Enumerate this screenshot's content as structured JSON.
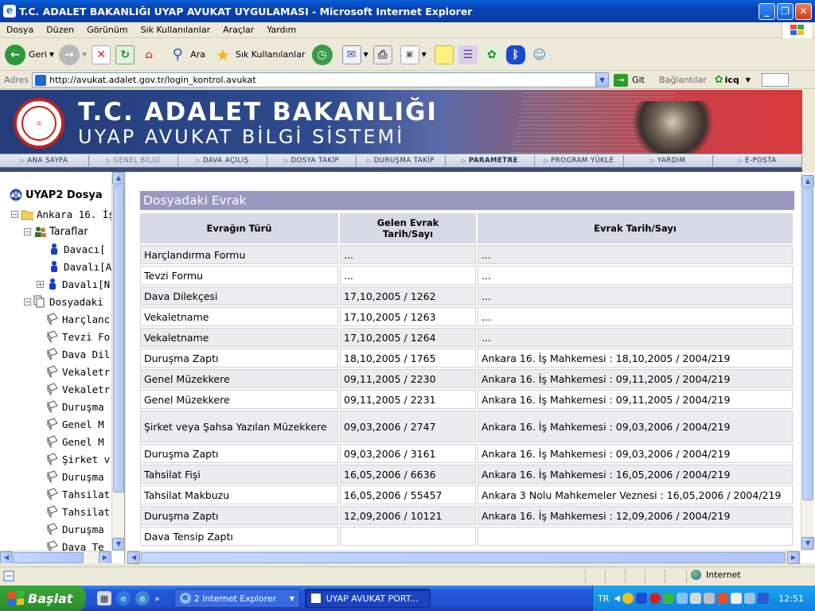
{
  "window": {
    "title": "T.C. ADALET BAKANLIĞI UYAP AVUKAT UYGULAMASI - Microsoft Internet Explorer"
  },
  "menu": [
    "Dosya",
    "Düzen",
    "Görünüm",
    "Sık Kullanılanlar",
    "Araçlar",
    "Yardım"
  ],
  "toolbar": {
    "back": "Geri",
    "search": "Ara",
    "favorites": "Sık Kullanılanlar"
  },
  "address": {
    "label": "Adres",
    "url": "http://avukat.adalet.gov.tr/login_kontrol.avukat",
    "go": "Git",
    "links": "Bağlantılar",
    "icq": "icq"
  },
  "banner": {
    "line1": "T.C. ADALET BAKANLIĞI",
    "line2": "UYAP AVUKAT BİLGİ SİSTEMİ",
    "seal_text": "T.C. ADALET BAKANLIĞI"
  },
  "nav": [
    "ANA SAYFA",
    "GENEL BİLGİ",
    "DAVA AÇILIŞ",
    "DOSYA TAKİP",
    "DURUŞMA TAKİP",
    "PARAMETRE",
    "PROGRAM YÜKLE",
    "YARDIM",
    "E-POSTA"
  ],
  "tree": {
    "root": "UYAP2 Dosya",
    "case": "Ankara 16. İş",
    "parties": "Taraflar",
    "party_items": [
      "Davacı[",
      "Davalı[A",
      "Davalı[N"
    ],
    "docs_folder": "Dosyadaki",
    "doc_items": [
      "Harçlanc",
      "Tevzi Fo",
      "Dava Dil",
      "Vekaletr",
      "Vekaletr",
      "Duruşma",
      "Genel M",
      "Genel M",
      "Şirket v",
      "Duruşma",
      "Tahsilat",
      "Tahsilat",
      "Duruşma",
      "Dava Te"
    ]
  },
  "docs": {
    "title": "Dosyadaki Evrak",
    "headers": [
      "Evrağın Türü",
      "Gelen Evrak Tarih/Sayı",
      "Evrak Tarih/Sayı"
    ],
    "rows": [
      [
        "Harçlandırma Formu",
        "...",
        "..."
      ],
      [
        "Tevzi Formu",
        "...",
        "..."
      ],
      [
        "Dava Dilekçesi",
        "17,10,2005 / 1262",
        "..."
      ],
      [
        "Vekaletname",
        "17,10,2005 / 1263",
        "..."
      ],
      [
        "Vekaletname",
        "17,10,2005 / 1264",
        "..."
      ],
      [
        "Duruşma Zaptı",
        "18,10,2005 / 1765",
        "Ankara 16. İş Mahkemesi : 18,10,2005 / 2004/219"
      ],
      [
        "Genel Müzekkere",
        "09,11,2005 / 2230",
        "Ankara 16. İş Mahkemesi : 09,11,2005 / 2004/219"
      ],
      [
        "Genel Müzekkere",
        "09,11,2005 / 2231",
        "Ankara 16. İş Mahkemesi : 09,11,2005 / 2004/219"
      ],
      [
        "Şirket veya Şahsa Yazılan Müzekkere",
        "09,03,2006 / 2747",
        "Ankara 16. İş Mahkemesi : 09,03,2006 / 2004/219"
      ],
      [
        "Duruşma Zaptı",
        "09,03,2006 / 3161",
        "Ankara 16. İş Mahkemesi : 09,03,2006 / 2004/219"
      ],
      [
        "Tahsilat Fişi",
        "16,05,2006 / 6636",
        "Ankara 16. İş Mahkemesi : 16,05,2006 / 2004/219"
      ],
      [
        "Tahsilat Makbuzu",
        "16,05,2006 / 55457",
        "Ankara 3 Nolu Mahkemeler Veznesi : 16,05,2006 / 2004/219"
      ],
      [
        "Duruşma Zaptı",
        "12,09,2006 / 10121",
        "Ankara 16. İş Mahkemesi : 12,09,2006 / 2004/219"
      ],
      [
        "Dava Tensip Zaptı",
        "",
        ""
      ]
    ]
  },
  "status": {
    "zone": "Internet"
  },
  "taskbar": {
    "start": "Başlat",
    "task1": "2 Internet Explorer",
    "task2": "UYAP AVUKAT PORT...",
    "lang": "TR",
    "clock": "12:51"
  }
}
